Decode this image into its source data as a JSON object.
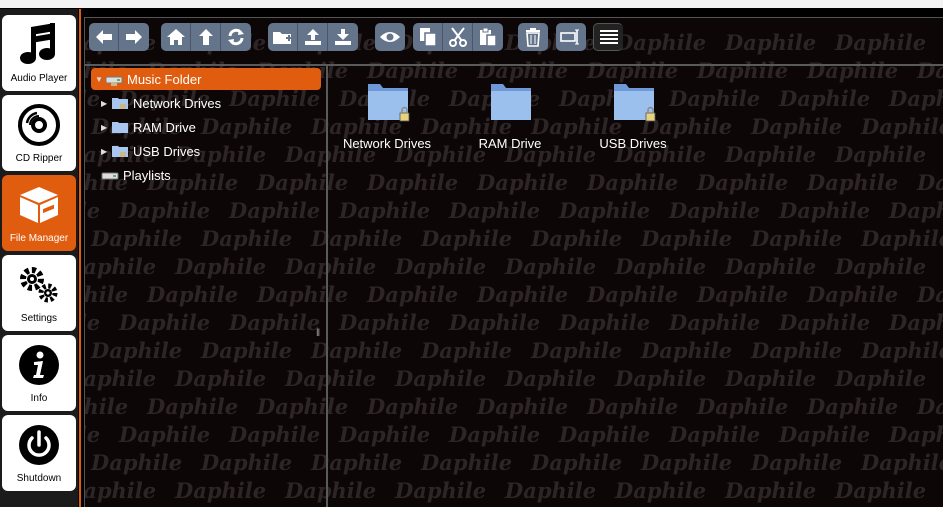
{
  "sidebar": {
    "items": [
      {
        "label": "Audio Player",
        "icon": "music-note-icon"
      },
      {
        "label": "CD Ripper",
        "icon": "disc-icon"
      },
      {
        "label": "File Manager",
        "icon": "box-icon",
        "active": true
      },
      {
        "label": "Settings",
        "icon": "gears-icon"
      },
      {
        "label": "Info",
        "icon": "info-icon"
      },
      {
        "label": "Shutdown",
        "icon": "power-icon"
      }
    ]
  },
  "watermark": {
    "text": "Daphile"
  },
  "toolbar": {
    "buttons": [
      "back-icon",
      "forward-icon",
      "home-icon",
      "up-icon",
      "refresh-icon",
      "new-folder-icon",
      "upload-icon",
      "download-icon",
      "view-icon",
      "copy-icon",
      "cut-icon",
      "paste-icon",
      "delete-icon",
      "rename-icon",
      "list-view-icon"
    ]
  },
  "tree": {
    "root": "Music Folder",
    "children": [
      "Network Drives",
      "RAM Drive",
      "USB Drives"
    ],
    "playlists": "Playlists"
  },
  "files": [
    {
      "name": "Network Drives",
      "locked": true
    },
    {
      "name": "RAM Drive",
      "locked": false
    },
    {
      "name": "USB Drives",
      "locked": true
    }
  ],
  "colors": {
    "accent": "#e05d10",
    "toolbar": "#64748a",
    "folder": "#8fb4e8"
  }
}
